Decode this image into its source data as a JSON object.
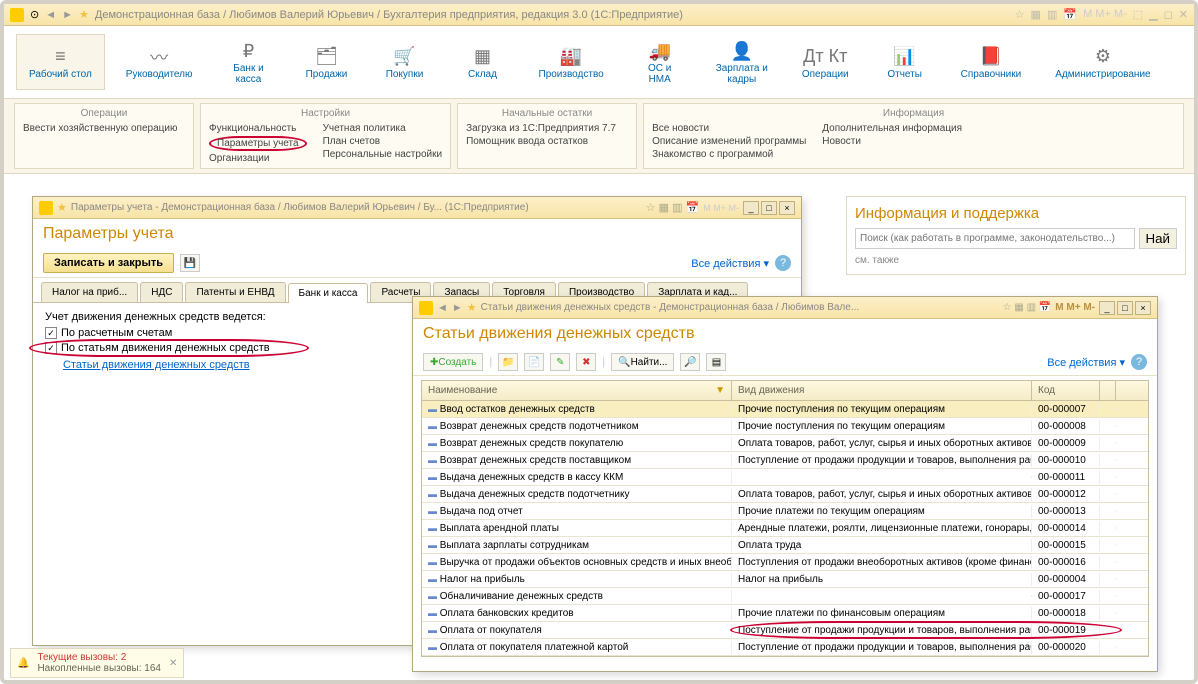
{
  "main_title": "Демонстрационная база / Любимов Валерий Юрьевич / Бухгалтерия предприятия, редакция 3.0  (1С:Предприятие)",
  "nav": [
    {
      "label": "Рабочий стол",
      "icon": "≡"
    },
    {
      "label": "Руководителю",
      "icon": "〰"
    },
    {
      "label": "Банк и касса",
      "icon": "₽"
    },
    {
      "label": "Продажи",
      "icon": "🗂"
    },
    {
      "label": "Покупки",
      "icon": "🛒"
    },
    {
      "label": "Склад",
      "icon": "▦"
    },
    {
      "label": "Производство",
      "icon": "🏭"
    },
    {
      "label": "ОС и НМА",
      "icon": "🚚"
    },
    {
      "label": "Зарплата и кадры",
      "icon": "👤"
    },
    {
      "label": "Операции",
      "icon": "Дт Кт"
    },
    {
      "label": "Отчеты",
      "icon": "📊"
    },
    {
      "label": "Справочники",
      "icon": "📕"
    },
    {
      "label": "Администрирование",
      "icon": "⚙"
    }
  ],
  "subpanels": {
    "ops": {
      "title": "Операции",
      "items": [
        "Ввести хозяйственную операцию"
      ]
    },
    "settings": {
      "title": "Настройки",
      "col1": [
        "Функциональность",
        "Параметры учета",
        "Организации"
      ],
      "col2": [
        "Учетная политика",
        "План счетов",
        "Персональные настройки"
      ]
    },
    "balance": {
      "title": "Начальные остатки",
      "items": [
        "Загрузка из 1С:Предприятия 7.7",
        "Помощник ввода остатков"
      ]
    },
    "info": {
      "title": "Информация",
      "col1": [
        "Все новости",
        "Описание изменений программы",
        "Знакомство с программой"
      ],
      "col2": [
        "Дополнительная информация",
        "Новости"
      ]
    }
  },
  "win1": {
    "title": "Параметры учета - Демонстрационная база / Любимов Валерий Юрьевич / Бу...  (1С:Предприятие)",
    "heading": "Параметры учета",
    "save_btn": "Записать и закрыть",
    "all_actions": "Все действия",
    "tabs": [
      "Налог на приб...",
      "НДС",
      "Патенты и ЕНВД",
      "Банк и касса",
      "Расчеты",
      "Запасы",
      "Торговля",
      "Производство",
      "Зарплата и кад..."
    ],
    "active_tab": 3,
    "form_label": "Учет движения денежных средств ведется:",
    "check1": "По расчетным счетам",
    "check2": "По статьям движения денежных средств",
    "link": "Статьи движения денежных средств"
  },
  "info_panel": {
    "heading": "Информация и поддержка",
    "search_placeholder": "Поиск (как работать в программе, законодательство...)",
    "search_btn": "Най",
    "also": "см. также"
  },
  "win2": {
    "title": "Статьи движения денежных средств - Демонстрационная база / Любимов Вале...",
    "tb_marks": [
      "M",
      "M+",
      "M-"
    ],
    "heading": "Статьи движения денежных средств",
    "create_btn": "Создать",
    "find_btn": "Найти...",
    "all_actions": "Все действия",
    "columns": {
      "name": "Наименование",
      "type": "Вид движения",
      "code": "Код"
    },
    "rows": [
      {
        "name": "Ввод остатков денежных средств",
        "type": "Прочие поступления по текущим операциям",
        "code": "00-000007",
        "selected": true
      },
      {
        "name": "Возврат денежных средств подотчетником",
        "type": "Прочие поступления по текущим операциям",
        "code": "00-000008"
      },
      {
        "name": "Возврат денежных средств покупателю",
        "type": "Оплата товаров, работ, услуг, сырья и иных оборотных активов",
        "code": "00-000009"
      },
      {
        "name": "Возврат денежных средств поставщиком",
        "type": "Поступление от продажи продукции и товаров, выполнения раб...",
        "code": "00-000010"
      },
      {
        "name": "Выдача денежных средств в кассу ККМ",
        "type": "",
        "code": "00-000011"
      },
      {
        "name": "Выдача денежных средств подотчетнику",
        "type": "Оплата товаров, работ, услуг, сырья и иных оборотных активов",
        "code": "00-000012"
      },
      {
        "name": "Выдача под отчет",
        "type": "Прочие платежи по текущим операциям",
        "code": "00-000013"
      },
      {
        "name": "Выплата арендной платы",
        "type": "Арендные платежи, роялти, лицензионные платежи, гонорары, к...",
        "code": "00-000014"
      },
      {
        "name": "Выплата зарплаты сотрудникам",
        "type": "Оплата труда",
        "code": "00-000015"
      },
      {
        "name": "Выручка от продажи объектов основных средств и иных внеобор...",
        "type": "Поступления от продажи внеоборотных активов (кроме финансов...",
        "code": "00-000016"
      },
      {
        "name": "Налог на прибыль",
        "type": "Налог на прибыль",
        "code": "00-000004"
      },
      {
        "name": "Обналичивание денежных средств",
        "type": "",
        "code": "00-000017"
      },
      {
        "name": "Оплата банковских кредитов",
        "type": "Прочие платежи по финансовым операциям",
        "code": "00-000018"
      },
      {
        "name": "Оплата от покупателя",
        "type": "Поступление от продажи продукции и товаров, выполнения раб...",
        "code": "00-000019"
      },
      {
        "name": "Оплата от покупателя платежной картой",
        "type": "Поступление от продажи продукции и товаров, выполнения раб...",
        "code": "00-000020"
      }
    ]
  },
  "status": {
    "line1": "Текущие вызовы: 2",
    "line2": "Накопленные вызовы: 164"
  }
}
